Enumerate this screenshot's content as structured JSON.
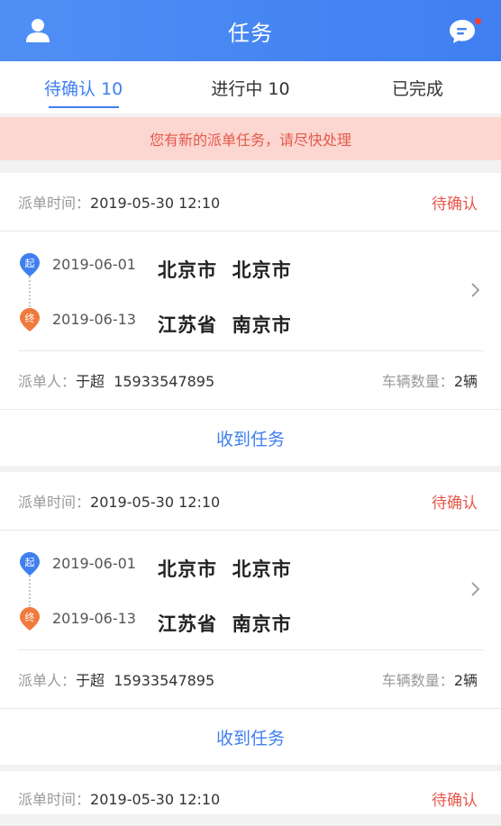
{
  "header": {
    "title": "任务"
  },
  "tabs": [
    {
      "label": "待确认 10"
    },
    {
      "label": "进行中 10"
    },
    {
      "label": "已完成"
    }
  ],
  "notice": "您有新的派单任务，请尽快处理",
  "labels": {
    "dispatch_time": "派单时间：",
    "dispatcher": "派单人：",
    "vehicle_count": "车辆数量：",
    "start_marker": "起",
    "end_marker": "终",
    "action": "收到任务"
  },
  "orders": [
    {
      "dispatch_time": "2019-05-30 12:10",
      "status": "待确认",
      "start_date": "2019-06-01",
      "start_city": "北京市  北京市",
      "end_date": "2019-06-13",
      "end_city": "江苏省  南京市",
      "dispatcher": "于超  15933547895",
      "vehicles": "2辆"
    },
    {
      "dispatch_time": "2019-05-30 12:10",
      "status": "待确认",
      "start_date": "2019-06-01",
      "start_city": "北京市  北京市",
      "end_date": "2019-06-13",
      "end_city": "江苏省  南京市",
      "dispatcher": "于超  15933547895",
      "vehicles": "2辆"
    },
    {
      "dispatch_time": "2019-05-30 12:10",
      "status": "待确认"
    }
  ],
  "colors": {
    "accent": "#3f7ff0",
    "status": "#e8574b",
    "notice_bg": "#fcd6d0",
    "start_marker": "#3f7ff0",
    "end_marker": "#f07a3e"
  },
  "icons": {
    "header_left": "user-icon",
    "header_right": "message-icon",
    "row_arrow": "chevron-right-icon"
  }
}
